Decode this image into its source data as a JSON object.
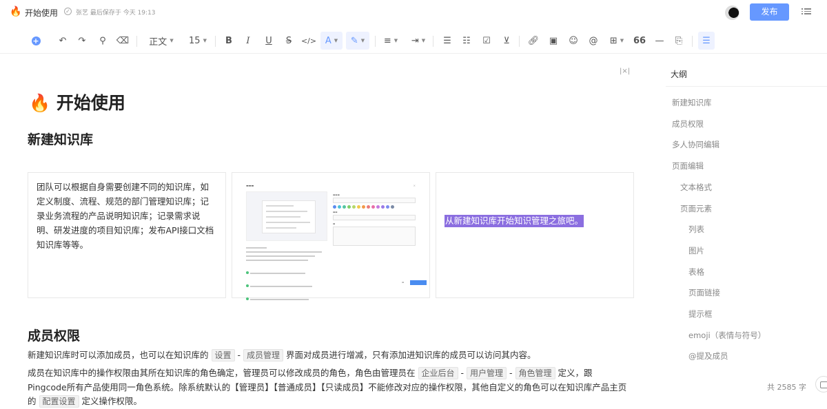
{
  "header": {
    "title_emoji": "🔥",
    "title": "开始使用",
    "saved_status": "张艺 最后保存于 今天 19:13",
    "publish_label": "发布"
  },
  "toolbar": {
    "paragraph_style": "正文",
    "font_size": "15",
    "quote_label": "66",
    "divider_label": "—"
  },
  "document": {
    "title_emoji": "🔥",
    "title": "开始使用",
    "section1_heading": "新建知识库",
    "card1_text": "团队可以根据自身需要创建不同的知识库，如定义制度、流程、规范的部门管理知识库；记录业务流程的产品说明知识库；记录需求说明、研发进度的项目知识库；发布API接口文档知识库等等。",
    "card3_highlight": "从新建知识库开始知识管理之旅吧。",
    "section2_heading": "成员权限",
    "para1": {
      "before": "新建知识库时可以添加成员，也可以在知识库的",
      "tag1": "设置",
      "dash": "-",
      "tag2": "成员管理",
      "after": "界面对成员进行增减，只有添加进知识库的成员可以访问其内容。"
    },
    "para2": {
      "before": "成员在知识库中的操作权限由其所在知识库的角色确定，管理员可以修改成员的角色，角色由管理员在",
      "tag1": "企业后台",
      "dash1": "-",
      "tag2": "用户管理",
      "dash2": "-",
      "tag3": "角色管理",
      "middle": "定义，跟Pingcode所有产品使用同一角色系统。除系统默认的【管理员】【普通成员】【只读成员】不能修改对应的操作权限，其他自定义的角色可以在知识库产品主页的",
      "tag4": "配置设置",
      "after": "定义操作权限。"
    }
  },
  "outline": {
    "title": "大纲",
    "items": [
      {
        "label": "新建知识库",
        "level": 1
      },
      {
        "label": "成员权限",
        "level": 1
      },
      {
        "label": "多人协同编辑",
        "level": 1
      },
      {
        "label": "页面编辑",
        "level": 1
      },
      {
        "label": "文本格式",
        "level": 2
      },
      {
        "label": "页面元素",
        "level": 2
      },
      {
        "label": "列表",
        "level": 3
      },
      {
        "label": "图片",
        "level": 3
      },
      {
        "label": "表格",
        "level": 3
      },
      {
        "label": "页面链接",
        "level": 3
      },
      {
        "label": "提示框",
        "level": 3
      },
      {
        "label": "emoji（表情与符号）",
        "level": 3
      },
      {
        "label": "@提及成员",
        "level": 3
      }
    ]
  },
  "footer": {
    "word_count": "共 2585 字"
  },
  "colors": {
    "accent": "#6698ff",
    "highlight": "#8b6ee0"
  }
}
